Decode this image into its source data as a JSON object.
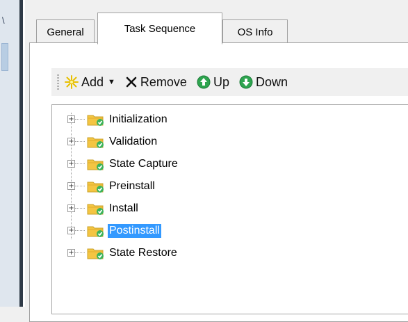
{
  "tabs": [
    {
      "label": "General",
      "active": false
    },
    {
      "label": "Task Sequence",
      "active": true
    },
    {
      "label": "OS Info",
      "active": false
    }
  ],
  "toolbar": {
    "add_label": "Add",
    "remove_label": "Remove",
    "up_label": "Up",
    "down_label": "Down"
  },
  "tree": {
    "items": [
      {
        "label": "Initialization",
        "selected": false
      },
      {
        "label": "Validation",
        "selected": false
      },
      {
        "label": "State Capture",
        "selected": false
      },
      {
        "label": "Preinstall",
        "selected": false
      },
      {
        "label": "Install",
        "selected": false
      },
      {
        "label": "Postinstall",
        "selected": true
      },
      {
        "label": "State Restore",
        "selected": false
      }
    ]
  },
  "colors": {
    "selection": "#3399ff",
    "up_arrow": "#2ea44f",
    "down_arrow": "#2ea44f",
    "add_star": "#e8c000"
  },
  "icons": {
    "add": "sparkle-add-icon",
    "remove": "x-remove-icon",
    "up": "green-up-arrow-icon",
    "down": "green-down-arrow-icon",
    "tree_group": "folder-check-icon"
  }
}
